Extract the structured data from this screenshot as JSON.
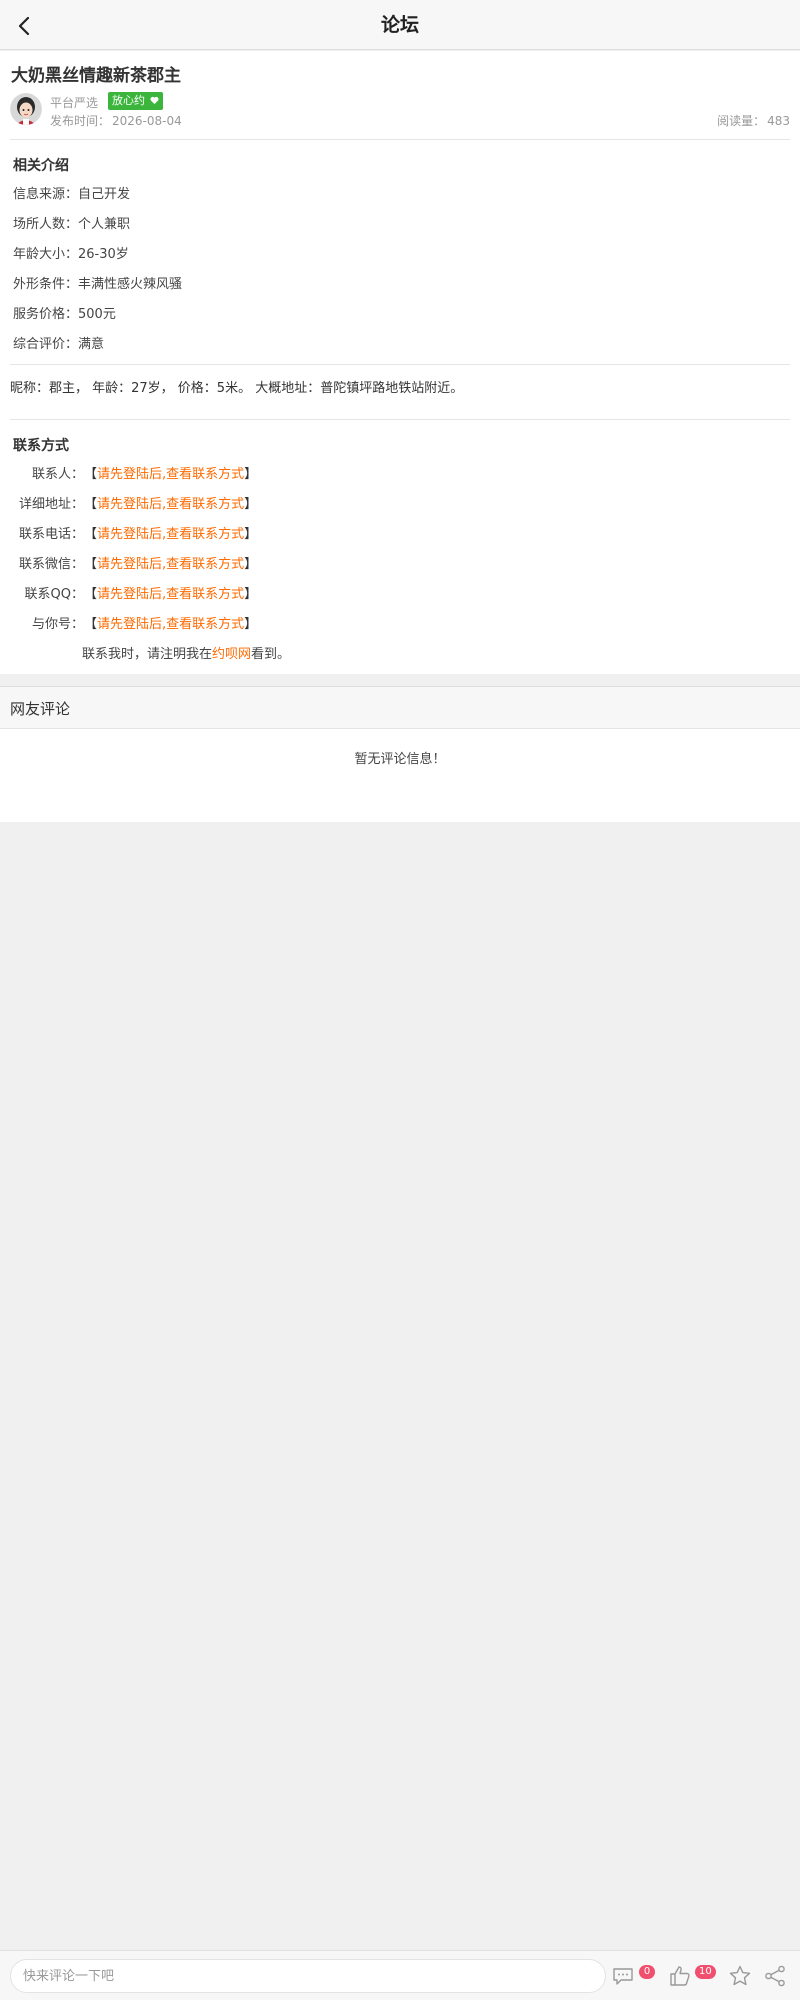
{
  "header": {
    "title": "论坛",
    "back_icon": "chevron-left-icon"
  },
  "article": {
    "title": "大奶黑丝情趣新茶郡主",
    "author": "平台严选",
    "badge": "放心约",
    "badge_icon": "heart-icon",
    "badge_color": "#3cb53c",
    "date_label": "发布时间：",
    "date": "2026-08-04",
    "views_label": "阅读量：",
    "views": "483"
  },
  "intro": {
    "title": "相关介绍",
    "rows": [
      {
        "label": "信息来源：",
        "value": "自己开发"
      },
      {
        "label": "场所人数：",
        "value": "个人兼职"
      },
      {
        "label": "年龄大小：",
        "value": "26-30岁"
      },
      {
        "label": "外形条件：",
        "value": "丰满性感火辣风骚"
      },
      {
        "label": "服务价格：",
        "value": "500元"
      },
      {
        "label": "综合评价：",
        "value": "满意"
      }
    ]
  },
  "description": "昵称：郡主， 年龄：27岁， 价格：5米。 大概地址：普陀镇坪路地铁站附近。",
  "contact": {
    "title": "联系方式",
    "bracket_open": "【",
    "bracket_close": "】",
    "link_text": "请先登陆后,查看联系方式",
    "link_color": "#ff6a00",
    "rows": [
      {
        "label": "联系人："
      },
      {
        "label": "详细地址："
      },
      {
        "label": "联系电话："
      },
      {
        "label": "联系微信："
      },
      {
        "label": "联系QQ："
      },
      {
        "label": "与你号："
      }
    ],
    "note_prefix": "联系我时，请注明我在",
    "note_site": "约呗网",
    "note_suffix": "看到。"
  },
  "comments": {
    "title": "网友评论",
    "empty": "暂无评论信息！"
  },
  "bottom_bar": {
    "input_placeholder": "快来评论一下吧",
    "comment_icon": "comment-icon",
    "comment_count": "0",
    "like_icon": "thumbs-up-icon",
    "like_count": "10",
    "favorite_icon": "star-icon",
    "share_icon": "share-icon",
    "badge_color": "#f0506e"
  }
}
